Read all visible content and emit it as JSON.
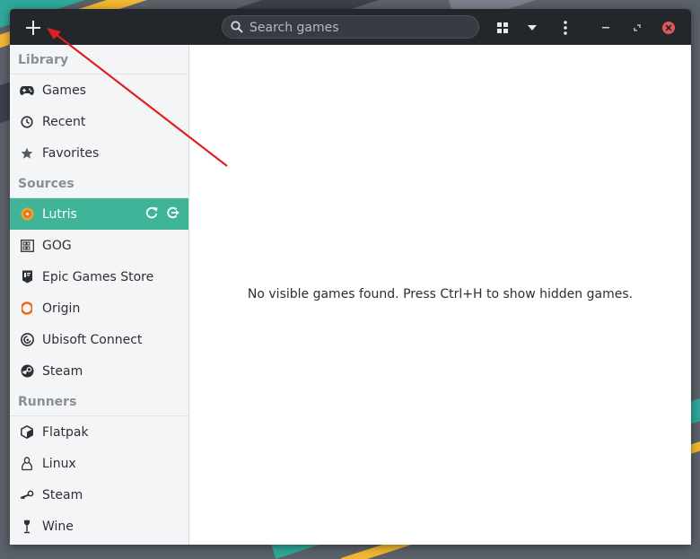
{
  "search": {
    "placeholder": "Search games"
  },
  "sidebar": {
    "library_header": "Library",
    "library_items": [
      {
        "label": "Games",
        "icon": "gamepad-icon"
      },
      {
        "label": "Recent",
        "icon": "clock-icon"
      },
      {
        "label": "Favorites",
        "icon": "star-icon"
      }
    ],
    "sources_header": "Sources",
    "source_items": [
      {
        "label": "Lutris",
        "icon": "lutris-icon",
        "active": true
      },
      {
        "label": "GOG",
        "icon": "gog-icon"
      },
      {
        "label": "Epic Games Store",
        "icon": "epic-icon"
      },
      {
        "label": "Origin",
        "icon": "origin-icon"
      },
      {
        "label": "Ubisoft Connect",
        "icon": "ubisoft-icon"
      },
      {
        "label": "Steam",
        "icon": "steam-icon"
      }
    ],
    "runners_header": "Runners",
    "runner_items": [
      {
        "label": "Flatpak",
        "icon": "flatpak-icon"
      },
      {
        "label": "Linux",
        "icon": "linux-icon"
      },
      {
        "label": "Steam",
        "icon": "steam-runner-icon"
      },
      {
        "label": "Wine",
        "icon": "wine-icon"
      }
    ]
  },
  "main": {
    "empty_message": "No visible games found. Press Ctrl+H to show hidden games."
  },
  "colors": {
    "accent": "#3fb499",
    "headerbar": "#23272c",
    "annotation_arrow": "#e02020",
    "close": "#e05a5a"
  }
}
